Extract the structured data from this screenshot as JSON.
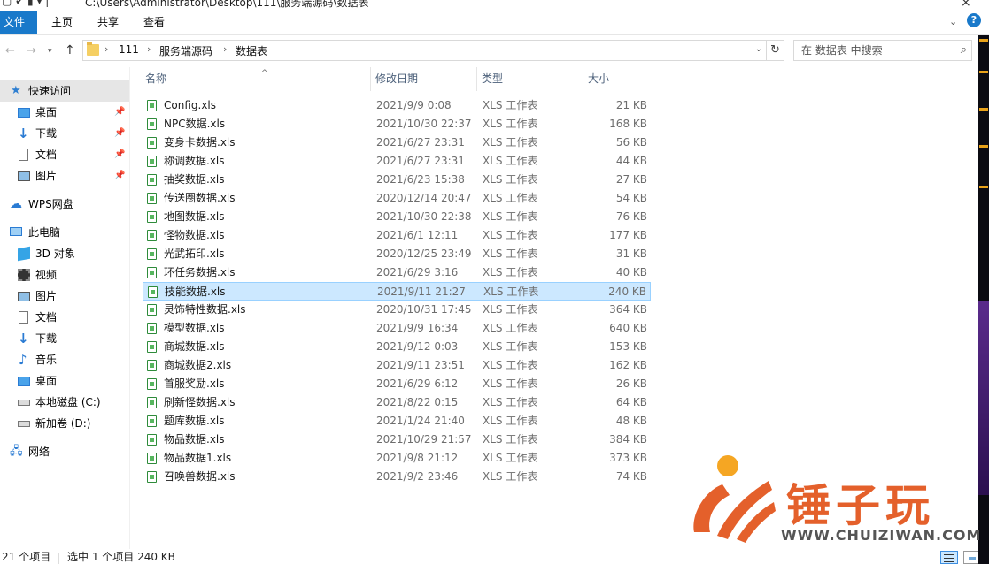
{
  "titlebar": {
    "path": "C:\\Users\\Administrator\\Desktop\\111\\服务端源码\\数据表"
  },
  "ribbon": {
    "tabs": [
      "文件",
      "主页",
      "共享",
      "查看"
    ]
  },
  "address": {
    "crumbs": [
      "111",
      "服务端源码",
      "数据表"
    ],
    "search_placeholder": "在 数据表 中搜索"
  },
  "sidebar": {
    "items": [
      {
        "label": "快速访问",
        "icon": "star-icon",
        "pinned": false,
        "active": true
      },
      {
        "label": "桌面",
        "icon": "desktop-icon",
        "pinned": true
      },
      {
        "label": "下载",
        "icon": "download-icon",
        "pinned": true
      },
      {
        "label": "文档",
        "icon": "document-icon",
        "pinned": true
      },
      {
        "label": "图片",
        "icon": "picture-icon",
        "pinned": true
      },
      {
        "label": "WPS网盘",
        "icon": "cloud-icon",
        "pinned": false
      },
      {
        "label": "此电脑",
        "icon": "computer-icon",
        "pinned": false
      },
      {
        "label": "3D 对象",
        "icon": "3d-objects-icon",
        "pinned": false
      },
      {
        "label": "视频",
        "icon": "video-icon",
        "pinned": false
      },
      {
        "label": "图片",
        "icon": "picture-icon",
        "pinned": false
      },
      {
        "label": "文档",
        "icon": "document-icon",
        "pinned": false
      },
      {
        "label": "下载",
        "icon": "download-icon",
        "pinned": false
      },
      {
        "label": "音乐",
        "icon": "music-icon",
        "pinned": false
      },
      {
        "label": "桌面",
        "icon": "desktop-icon",
        "pinned": false
      },
      {
        "label": "本地磁盘 (C:)",
        "icon": "disk-icon",
        "pinned": false
      },
      {
        "label": "新加卷 (D:)",
        "icon": "disk-icon",
        "pinned": false
      },
      {
        "label": "网络",
        "icon": "network-icon",
        "pinned": false
      }
    ]
  },
  "columns": {
    "name": "名称",
    "date": "修改日期",
    "type": "类型",
    "size": "大小"
  },
  "files": [
    {
      "name": "Config.xls",
      "date": "2021/9/9 0:08",
      "type": "XLS 工作表",
      "size": "21 KB"
    },
    {
      "name": "NPC数据.xls",
      "date": "2021/10/30 22:37",
      "type": "XLS 工作表",
      "size": "168 KB"
    },
    {
      "name": "变身卡数据.xls",
      "date": "2021/6/27 23:31",
      "type": "XLS 工作表",
      "size": "56 KB"
    },
    {
      "name": "称调数据.xls",
      "date": "2021/6/27 23:31",
      "type": "XLS 工作表",
      "size": "44 KB"
    },
    {
      "name": "抽奖数据.xls",
      "date": "2021/6/23 15:38",
      "type": "XLS 工作表",
      "size": "27 KB"
    },
    {
      "name": "传送圈数据.xls",
      "date": "2020/12/14 20:47",
      "type": "XLS 工作表",
      "size": "54 KB"
    },
    {
      "name": "地图数据.xls",
      "date": "2021/10/30 22:38",
      "type": "XLS 工作表",
      "size": "76 KB"
    },
    {
      "name": "怪物数据.xls",
      "date": "2021/6/1 12:11",
      "type": "XLS 工作表",
      "size": "177 KB"
    },
    {
      "name": "光武拓印.xls",
      "date": "2020/12/25 23:49",
      "type": "XLS 工作表",
      "size": "31 KB"
    },
    {
      "name": "环任务数据.xls",
      "date": "2021/6/29 3:16",
      "type": "XLS 工作表",
      "size": "40 KB"
    },
    {
      "name": "技能数据.xls",
      "date": "2021/9/11 21:27",
      "type": "XLS 工作表",
      "size": "240 KB",
      "selected": true
    },
    {
      "name": "灵饰特性数据.xls",
      "date": "2020/10/31 17:45",
      "type": "XLS 工作表",
      "size": "364 KB"
    },
    {
      "name": "模型数据.xls",
      "date": "2021/9/9 16:34",
      "type": "XLS 工作表",
      "size": "640 KB"
    },
    {
      "name": "商城数据.xls",
      "date": "2021/9/12 0:03",
      "type": "XLS 工作表",
      "size": "153 KB"
    },
    {
      "name": "商城数据2.xls",
      "date": "2021/9/11 23:51",
      "type": "XLS 工作表",
      "size": "162 KB"
    },
    {
      "name": "首服奖励.xls",
      "date": "2021/6/29 6:12",
      "type": "XLS 工作表",
      "size": "26 KB"
    },
    {
      "name": "刷新怪数据.xls",
      "date": "2021/8/22 0:15",
      "type": "XLS 工作表",
      "size": "64 KB"
    },
    {
      "name": "题库数据.xls",
      "date": "2021/1/24 21:40",
      "type": "XLS 工作表",
      "size": "48 KB"
    },
    {
      "name": "物品数据.xls",
      "date": "2021/10/29 21:57",
      "type": "XLS 工作表",
      "size": "384 KB"
    },
    {
      "name": "物品数据1.xls",
      "date": "2021/9/8 21:12",
      "type": "XLS 工作表",
      "size": "373 KB"
    },
    {
      "name": "召唤兽数据.xls",
      "date": "2021/9/2 23:46",
      "type": "XLS 工作表",
      "size": "74 KB"
    }
  ],
  "status": {
    "count": "21 个项目",
    "selection": "选中 1 个项目  240 KB"
  },
  "watermark": {
    "brand": "锤子玩",
    "url": "WWW.CHUIZIWAN.COM"
  },
  "colors": {
    "accent": "#1979ca",
    "selection": "#cce8ff",
    "watermark": "#e4602b"
  }
}
